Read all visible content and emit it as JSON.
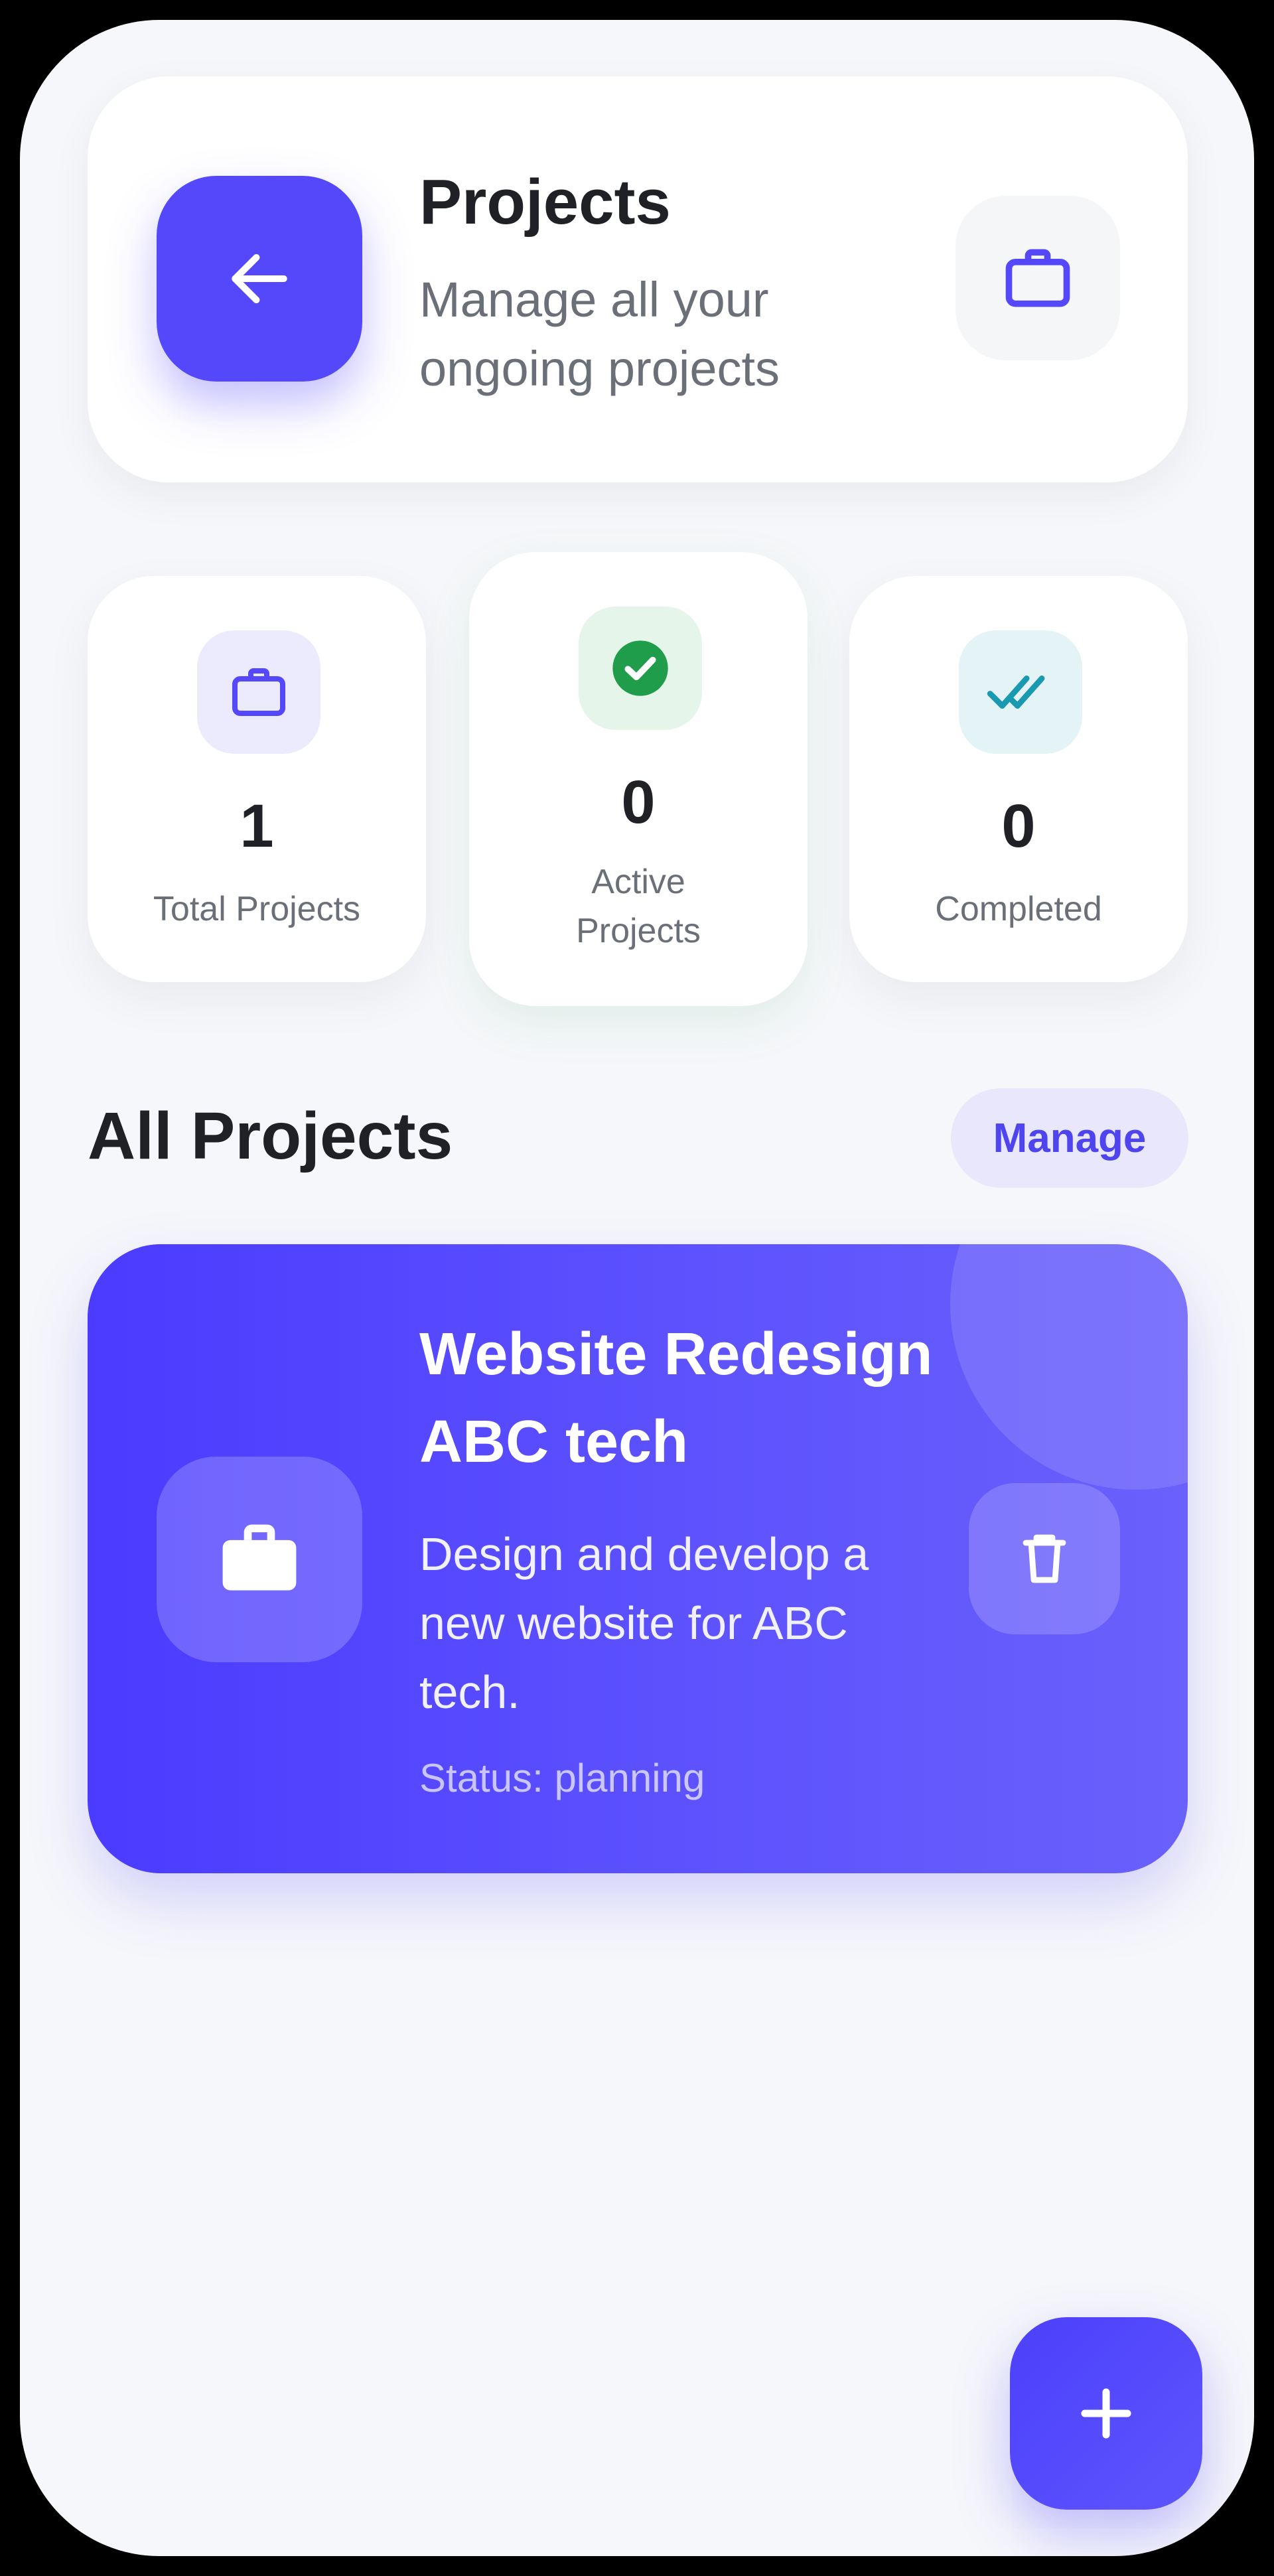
{
  "header": {
    "title": "Projects",
    "subtitle": "Manage all your ongoing projects",
    "back_icon": "arrow-left-icon",
    "briefcase_icon": "briefcase-icon",
    "accent": "#5548fb"
  },
  "stats": [
    {
      "value": "1",
      "label": "Total Projects",
      "icon": "briefcase-icon",
      "color": "#5548fb",
      "bg": "#ecebfd"
    },
    {
      "value": "0",
      "label": "Active Projects",
      "icon": "check-circle-icon",
      "color": "#1f9d4a",
      "bg": "#e6f5ea"
    },
    {
      "value": "0",
      "label": "Completed",
      "icon": "double-check-icon",
      "color": "#1a9ab0",
      "bg": "#e3f3f6"
    }
  ],
  "section": {
    "title": "All Projects",
    "manage_label": "Manage"
  },
  "projects": [
    {
      "title": "Website Redesign ABC tech",
      "description": "Design and develop a new website for ABC tech.",
      "status": "Status: planning",
      "icon": "briefcase-icon",
      "delete_icon": "trash-icon"
    }
  ],
  "fab": {
    "icon": "plus-icon"
  }
}
